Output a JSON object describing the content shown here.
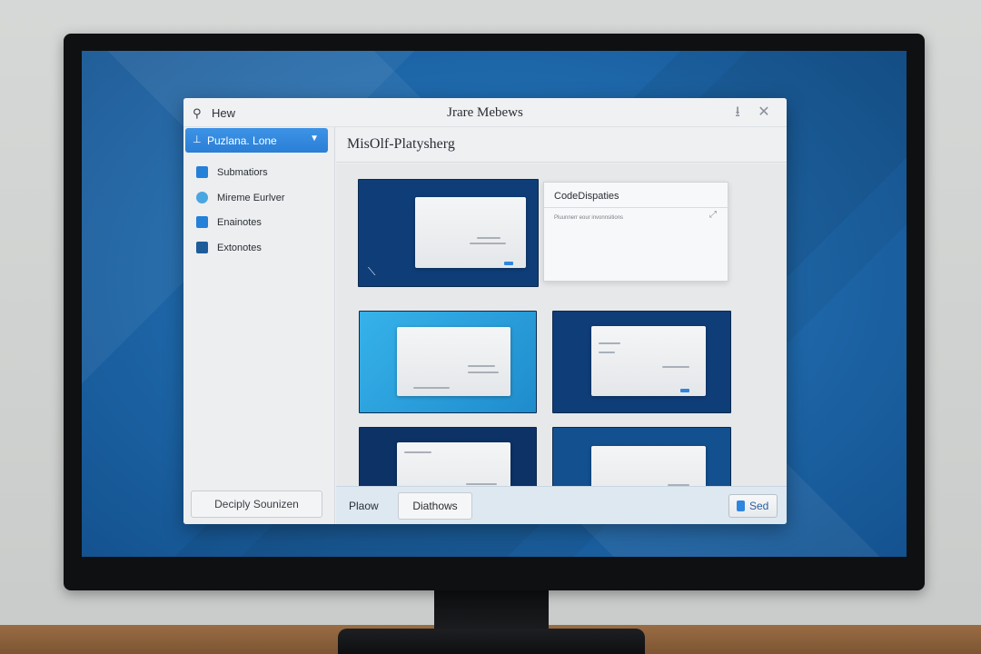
{
  "window": {
    "app_name": "Hew",
    "title": "Jrare Mebews",
    "pin_glyph": "⭳",
    "close_glyph": "✕"
  },
  "sidebar": {
    "selected": {
      "label": "Puzlana. Lone",
      "icon": "⊥"
    },
    "items": [
      {
        "label": "Submatiors"
      },
      {
        "label": "Mireme Eurlver"
      },
      {
        "label": "Enainotes"
      },
      {
        "label": "Extonotes"
      }
    ],
    "footer_button": "Deciply Sounizen"
  },
  "main": {
    "title": "MisOlf-Platysherg",
    "panel": {
      "title": "CodeDispaties",
      "subtitle": "Pluunnerr eour invonnsitions"
    }
  },
  "bottom_bar": {
    "label": "Plaow",
    "button": "Diathows",
    "send": "Sed"
  },
  "colors": {
    "accent": "#2a7fd6",
    "thumb_dark": "#0f3d78",
    "thumb_light": "#2aa3dd"
  }
}
